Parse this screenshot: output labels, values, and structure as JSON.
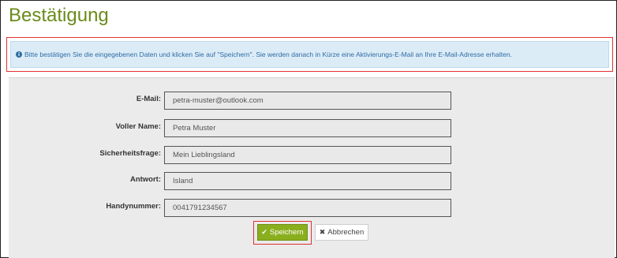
{
  "page": {
    "title": "Bestätigung"
  },
  "info": {
    "icon": "info-circle-icon",
    "text": "Bitte bestätigen Sie die eingegebenen Daten und klicken Sie auf \"Speichern\". Sie werden danach in Kürze eine Aktivierungs-E-Mail an Ihre E-Mail-Adresse erhalten."
  },
  "form": {
    "fields": [
      {
        "label": "E-Mail:",
        "value": "petra-muster@outlook.com"
      },
      {
        "label": "Voller Name:",
        "value": "Petra Muster"
      },
      {
        "label": "Sicherheitsfrage:",
        "value": "Mein Lieblingsland"
      },
      {
        "label": "Antwort:",
        "value": "Island"
      },
      {
        "label": "Handynummer:",
        "value": "0041791234567"
      }
    ]
  },
  "buttons": {
    "save": {
      "label": "Speichern",
      "icon": "checkmark-icon"
    },
    "cancel": {
      "label": "Abbrechen",
      "icon": "x-icon"
    }
  },
  "colors": {
    "title": "#6a8b1a",
    "info_bg": "#dcecf7",
    "info_text": "#2e6da4",
    "save_bg": "#8aaf1e",
    "highlight": "#e03131"
  }
}
